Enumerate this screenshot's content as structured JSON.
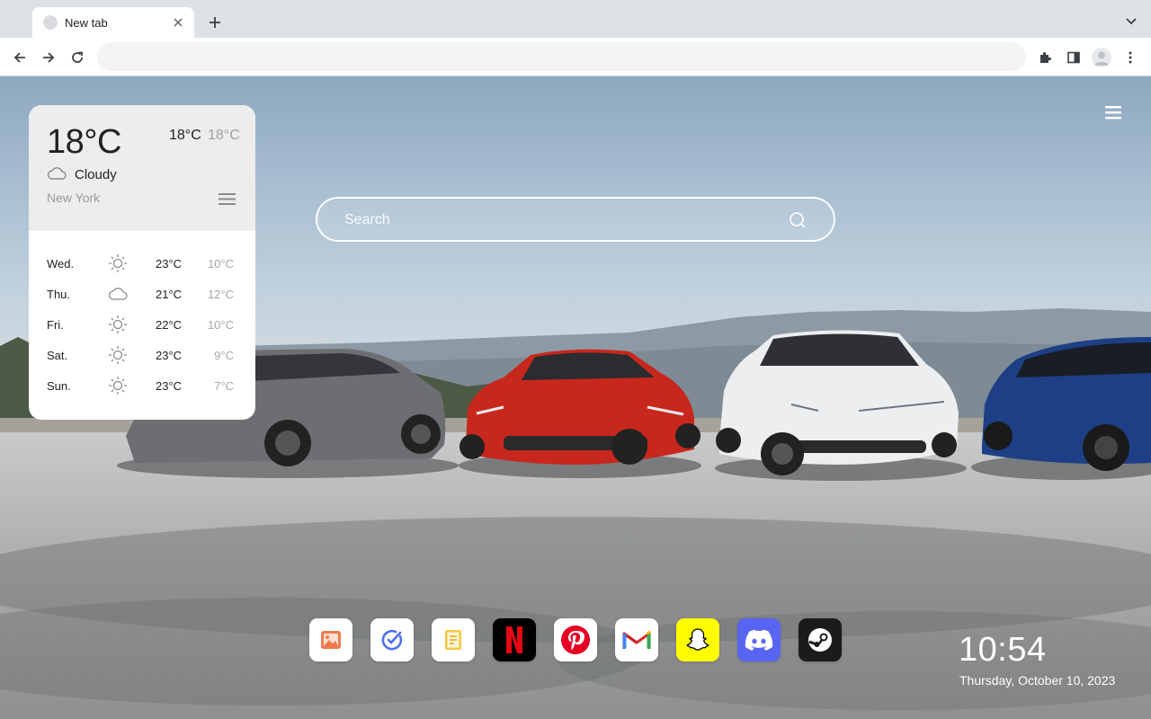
{
  "browser": {
    "tab": {
      "title": "New tab"
    },
    "omnibox": {
      "value": "",
      "placeholder": ""
    }
  },
  "weather": {
    "current_temp": "18°C",
    "high": "18°C",
    "low": "18°C",
    "condition": "Cloudy",
    "condition_icon": "cloud-icon",
    "city": "New York",
    "forecast": [
      {
        "day": "Wed.",
        "icon": "sun-icon",
        "high": "23°C",
        "low": "10°C"
      },
      {
        "day": "Thu.",
        "icon": "cloud-icon",
        "high": "21°C",
        "low": "12°C"
      },
      {
        "day": "Fri.",
        "icon": "sun-icon",
        "high": "22°C",
        "low": "10°C"
      },
      {
        "day": "Sat.",
        "icon": "sun-icon",
        "high": "23°C",
        "low": "9°C"
      },
      {
        "day": "Sun.",
        "icon": "sun-icon",
        "high": "23°C",
        "low": "7°C"
      }
    ]
  },
  "search": {
    "placeholder": "Search"
  },
  "dock": {
    "apps": [
      {
        "name": "gallery",
        "icon": "photo-icon",
        "color": "#ffffff"
      },
      {
        "name": "tasks",
        "icon": "check-circle-icon",
        "color": "#ffffff"
      },
      {
        "name": "notes",
        "icon": "notes-icon",
        "color": "#ffffff"
      },
      {
        "name": "netflix",
        "icon": "netflix-icon",
        "color": "#000000"
      },
      {
        "name": "pinterest",
        "icon": "pinterest-icon",
        "color": "#ffffff"
      },
      {
        "name": "gmail",
        "icon": "gmail-icon",
        "color": "#ffffff"
      },
      {
        "name": "snapchat",
        "icon": "snapchat-icon",
        "color": "#fffc00"
      },
      {
        "name": "discord",
        "icon": "discord-icon",
        "color": "#5865f2"
      },
      {
        "name": "steam",
        "icon": "steam-icon",
        "color": "#1b1b1b"
      }
    ]
  },
  "clock": {
    "time": "10:54",
    "date": "Thursday, October 10, 2023"
  },
  "colors": {
    "accent_red": "#e50914",
    "pinterest": "#e60023",
    "discord": "#5865f2",
    "snapchat": "#fffc00"
  }
}
